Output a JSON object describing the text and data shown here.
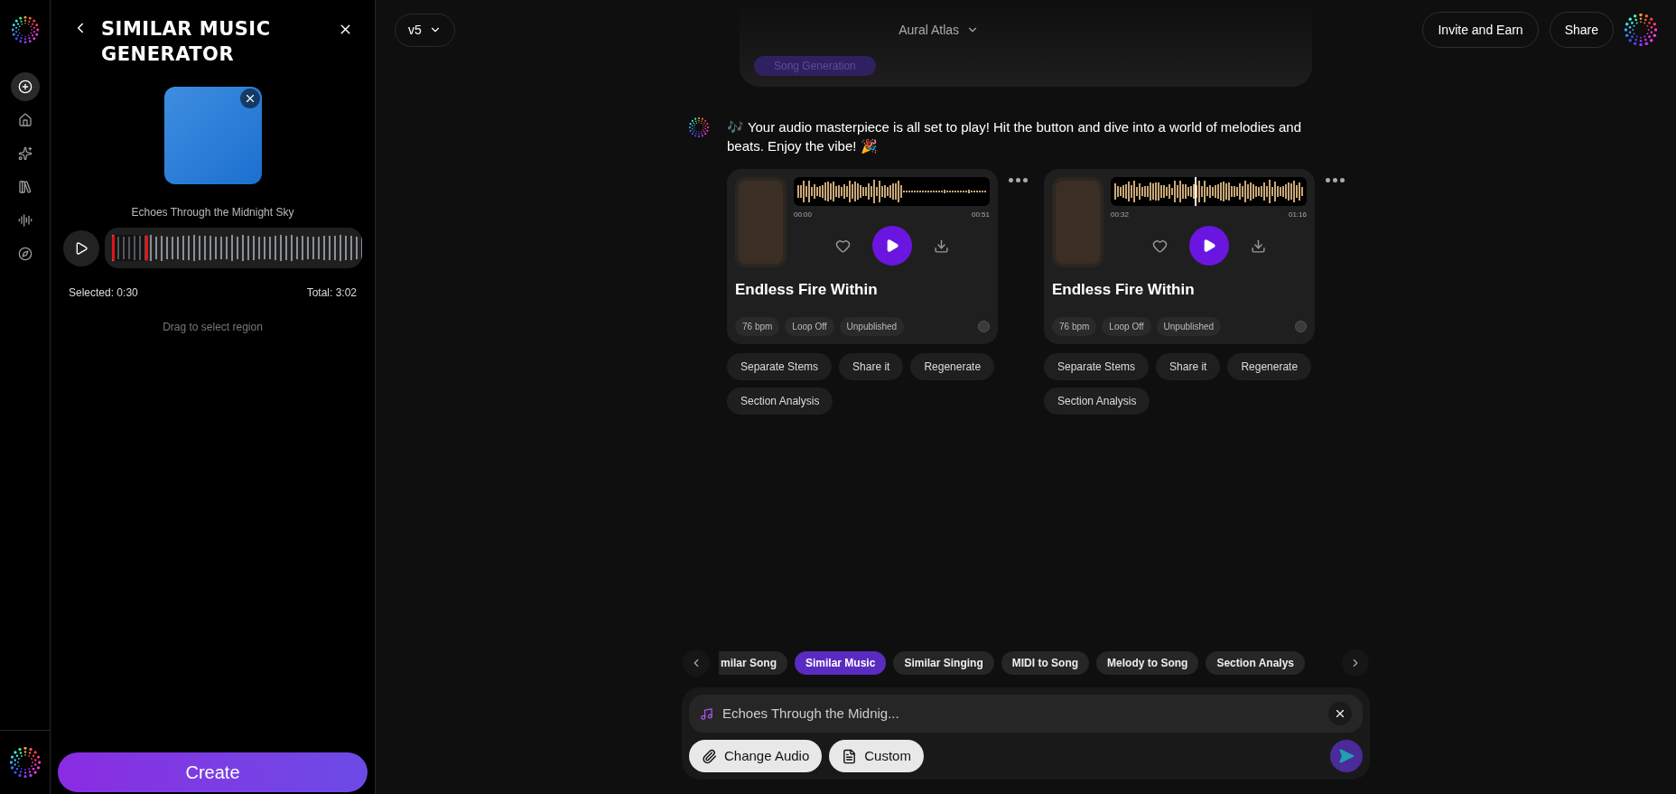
{
  "sidebar": {
    "items": [
      {
        "kind": "create",
        "selected": true
      },
      {
        "kind": "home",
        "selected": false
      },
      {
        "kind": "sparkle",
        "selected": false
      },
      {
        "kind": "library",
        "selected": false
      },
      {
        "kind": "effects",
        "selected": false
      },
      {
        "kind": "explore",
        "selected": false
      }
    ]
  },
  "panel": {
    "title": "SIMILAR MUSIC GENERATOR",
    "song_title": "Echoes Through the Midnight Sky",
    "waveform": {
      "level": 0.14
    },
    "selected": "Selected: 0:30",
    "total": "Total: 3:02",
    "hint": "Drag to select region",
    "create_button": "Create"
  },
  "header": {
    "version": "v5",
    "project": "Aural Atlas",
    "buttons": [
      "Invite and Earn",
      "Share"
    ]
  },
  "previous_message": {
    "chip": "Song Generation"
  },
  "message": {
    "text": "🎶 Your audio masterpiece is all set to play! Hit the button and dive into a world of melodies and beats. Enjoy the vibe! 🎉",
    "cards": [
      {
        "title": "Endless Fire Within",
        "start": "00:00",
        "end": "00:51",
        "tags": [
          "76 bpm",
          "Loop Off",
          "Unpublished"
        ],
        "actions": [
          "Separate Stems",
          "Share it",
          "Regenerate",
          "Section Analysis"
        ]
      },
      {
        "title": "Endless Fire Within",
        "start": "00:32",
        "end": "01:16",
        "level": 0.43,
        "tags": [
          "76 bpm",
          "Loop Off",
          "Unpublished"
        ],
        "actions": [
          "Separate Stems",
          "Share it",
          "Regenerate",
          "Section Analysis"
        ]
      }
    ]
  },
  "modes": [
    {
      "label": "milar Song",
      "selected": false
    },
    {
      "label": "Similar Music",
      "selected": true
    },
    {
      "label": "Similar Singing",
      "selected": false
    },
    {
      "label": "MIDI to Song",
      "selected": false
    },
    {
      "label": "Melody to Song",
      "selected": false
    },
    {
      "label": "Section Analys",
      "selected": false
    }
  ],
  "composer": {
    "value": "Echoes Through the Midnig...",
    "buttons": [
      "Change Audio",
      "Custom"
    ]
  }
}
